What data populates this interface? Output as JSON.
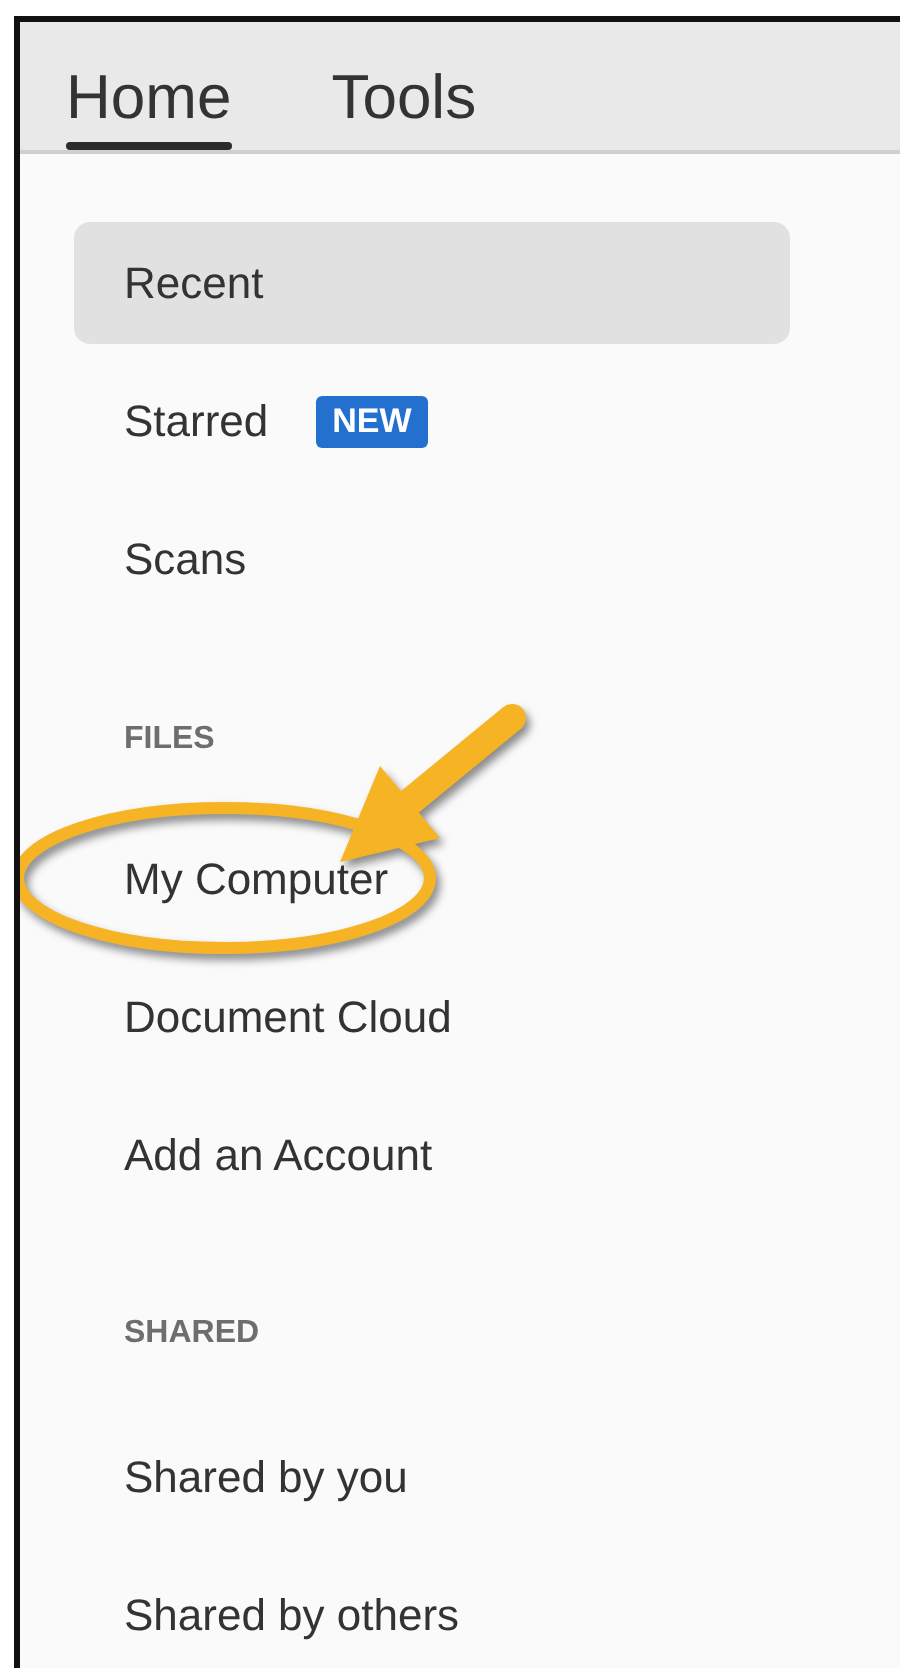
{
  "tabs": [
    {
      "label": "Home",
      "selected": true
    },
    {
      "label": "Tools",
      "selected": false
    }
  ],
  "sections": [
    {
      "items": [
        {
          "label": "Recent",
          "selected": true,
          "highlighted": false
        },
        {
          "label": "Starred",
          "selected": false,
          "highlighted": false,
          "badge": "NEW"
        },
        {
          "label": "Scans",
          "selected": false,
          "highlighted": false
        }
      ]
    },
    {
      "heading": "FILES",
      "items": [
        {
          "label": "My Computer",
          "selected": false,
          "highlighted": true
        },
        {
          "label": "Document Cloud",
          "selected": false,
          "highlighted": false
        },
        {
          "label": "Add an Account",
          "selected": false,
          "highlighted": false
        }
      ]
    },
    {
      "heading": "SHARED",
      "items": [
        {
          "label": "Shared by you",
          "selected": false,
          "highlighted": false
        },
        {
          "label": "Shared by others",
          "selected": false,
          "highlighted": false
        }
      ]
    }
  ]
}
